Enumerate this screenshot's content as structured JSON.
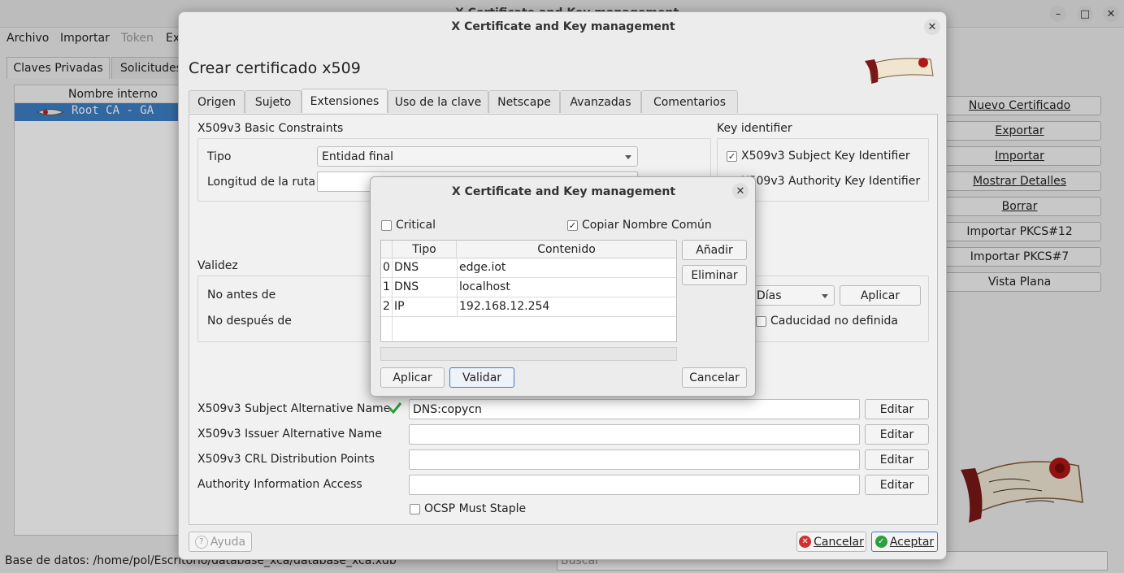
{
  "main": {
    "title": "X Certificate and Key management",
    "menu": [
      "Archivo",
      "Importar",
      "Token",
      "Ex"
    ],
    "tabs": [
      "Claves Privadas",
      "Solicitudes"
    ],
    "list_header": "Nombre interno",
    "list_items": [
      "Root CA - GA"
    ],
    "buttons": [
      "Nuevo Certificado",
      "Exportar",
      "Importar",
      "Mostrar Detalles",
      "Borrar",
      "Importar PKCS#12",
      "Importar PKCS#7",
      "Vista Plana"
    ],
    "status": "Base de datos: /home/pol/Escritorio/database_xca/database_xca.xdb",
    "search_placeholder": "Buscar"
  },
  "dialog": {
    "title": "X Certificate and Key management",
    "heading": "Crear certificado x509",
    "tabs": [
      "Origen",
      "Sujeto",
      "Extensiones",
      "Uso de la clave",
      "Netscape",
      "Avanzadas",
      "Comentarios"
    ],
    "basic_constraints": {
      "title": "X509v3 Basic Constraints",
      "tipo_label": "Tipo",
      "tipo_value": "Entidad final",
      "ruta_label": "Longitud de la ruta"
    },
    "key_identifier": {
      "title": "Key identifier",
      "subject": "X509v3 Subject Key Identifier",
      "authority": "X509v3 Authority Key Identifier"
    },
    "validez": {
      "title": "Validez",
      "no_antes": "No antes de",
      "no_despues": "No después de",
      "unit": "Días",
      "apply": "Aplicar",
      "undefined": "Caducidad no definida"
    },
    "extensions": [
      {
        "label": "X509v3 Subject Alternative Name",
        "value": "DNS:copycn",
        "button": "Editar"
      },
      {
        "label": "X509v3 Issuer Alternative Name",
        "value": "",
        "button": "Editar"
      },
      {
        "label": "X509v3 CRL Distribution Points",
        "value": "",
        "button": "Editar"
      },
      {
        "label": "Authority Information Access",
        "value": "",
        "button": "Editar"
      }
    ],
    "ocsp": "OCSP Must Staple",
    "help": "Ayuda",
    "cancel": "Cancelar",
    "accept": "Aceptar"
  },
  "modal": {
    "title": "X Certificate and Key management",
    "critical": "Critical",
    "copy_cn": "Copiar Nombre Común",
    "columns": [
      "Tipo",
      "Contenido"
    ],
    "rows": [
      {
        "idx": "0",
        "tipo": "DNS",
        "contenido": "edge.iot"
      },
      {
        "idx": "1",
        "tipo": "DNS",
        "contenido": "localhost"
      },
      {
        "idx": "2",
        "tipo": "IP",
        "contenido": "192.168.12.254"
      }
    ],
    "add": "Añadir",
    "remove": "Eliminar",
    "apply": "Aplicar",
    "validate": "Validar",
    "cancel": "Cancelar"
  },
  "colors": {
    "selection": "#3d7fc6",
    "check_green": "#2e9e3e",
    "cancel_red": "#d03030"
  }
}
